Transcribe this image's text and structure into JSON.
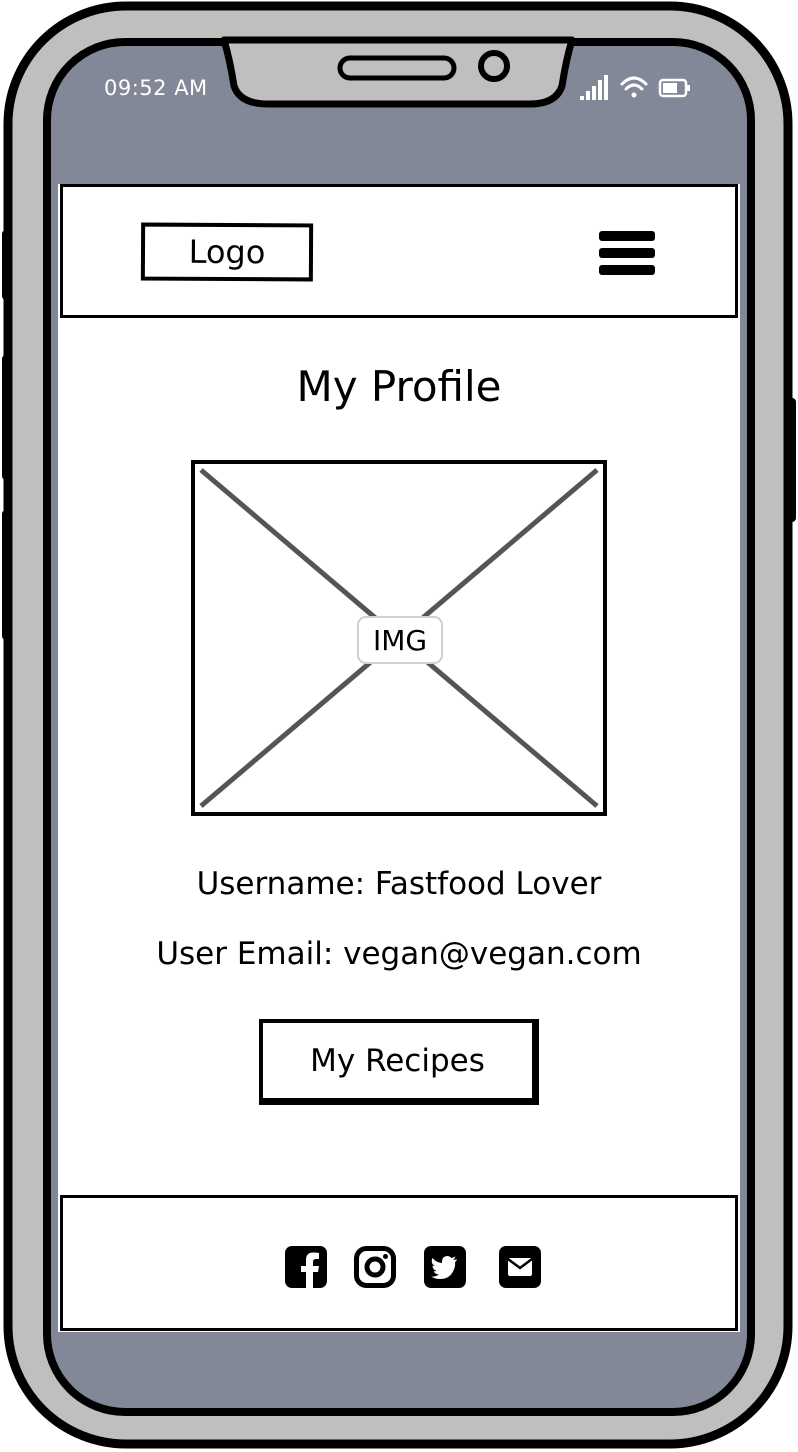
{
  "status_bar": {
    "time": "09:52 AM",
    "icons": [
      "signal-icon",
      "wifi-icon",
      "battery-icon"
    ]
  },
  "header": {
    "logo": "Logo",
    "menu_icon": "hamburger-menu-icon"
  },
  "main": {
    "title": "My Profile",
    "image_label": "IMG",
    "username_line": "Username: Fastfood Lover",
    "email_line": "User Email: vegan@vegan.com",
    "recipes_button": "My Recipes"
  },
  "footer": {
    "social_icons": [
      "facebook-icon",
      "instagram-icon",
      "twitter-icon",
      "email-icon"
    ]
  },
  "colors": {
    "phone_body": "#bfbfbf",
    "screen_chrome": "#828898",
    "outline": "#000000",
    "content_bg": "#ffffff"
  }
}
